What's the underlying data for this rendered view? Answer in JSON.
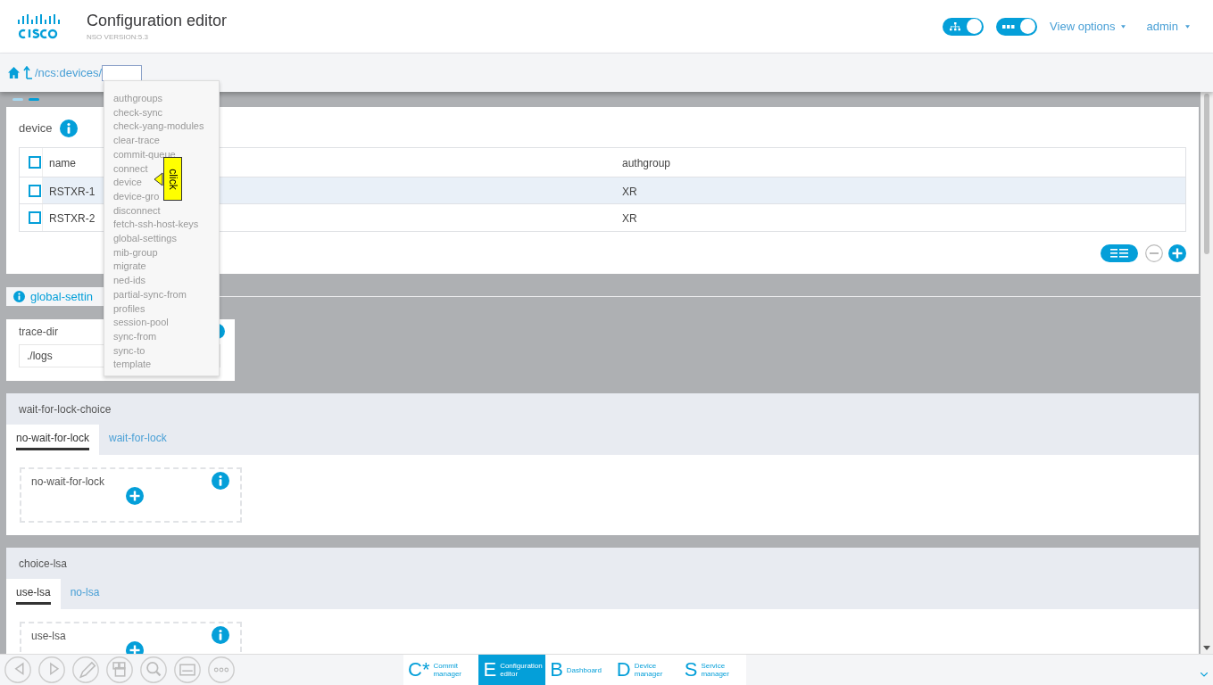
{
  "header": {
    "title": "Configuration editor",
    "version": "NSO VERSION:5.3",
    "toggles": [
      {
        "kind": "tree",
        "on": true
      },
      {
        "kind": "dots",
        "on": true
      }
    ],
    "view_options": "View options",
    "user": "admin"
  },
  "breadcrumb": {
    "path": "/ncs:devices/"
  },
  "dropdown": {
    "items": [
      "authgroups",
      "check-sync",
      "check-yang-modules",
      "clear-trace",
      "commit-queue",
      "connect",
      "device",
      "device-gro",
      "disconnect",
      "fetch-ssh-host-keys",
      "global-settings",
      "mib-group",
      "migrate",
      "ned-ids",
      "partial-sync-from",
      "profiles",
      "session-pool",
      "sync-from",
      "sync-to",
      "template"
    ],
    "tooltip": "click"
  },
  "device": {
    "title": "device",
    "columns": [
      "name",
      "authgroup"
    ],
    "all_checked": false,
    "rows": [
      {
        "name": "RSTXR-1",
        "authgroup": "XR",
        "selected": true,
        "checked": false
      },
      {
        "name": "RSTXR-2",
        "authgroup": "XR",
        "selected": false,
        "checked": false
      }
    ]
  },
  "global_settings": {
    "title": "global-settin",
    "trace_dir": {
      "label": "trace-dir",
      "value": "./logs"
    }
  },
  "choices": [
    {
      "title": "wait-for-lock-choice",
      "tabs": [
        {
          "label": "no-wait-for-lock",
          "selected": true
        },
        {
          "label": "wait-for-lock",
          "selected": false
        }
      ],
      "case_title": "no-wait-for-lock"
    },
    {
      "title": "choice-lsa",
      "tabs": [
        {
          "label": "use-lsa",
          "selected": true
        },
        {
          "label": "no-lsa",
          "selected": false
        }
      ],
      "case_title": "use-lsa"
    }
  ],
  "bottom_nav": [
    {
      "letter": "C*",
      "label": "Commit manager",
      "selected": false
    },
    {
      "letter": "E",
      "label": "Configuration editor",
      "selected": true
    },
    {
      "letter": "B",
      "label": "Dashboard",
      "selected": false
    },
    {
      "letter": "D",
      "label": "Device manager",
      "selected": false
    },
    {
      "letter": "S",
      "label": "Service manager",
      "selected": false
    }
  ]
}
